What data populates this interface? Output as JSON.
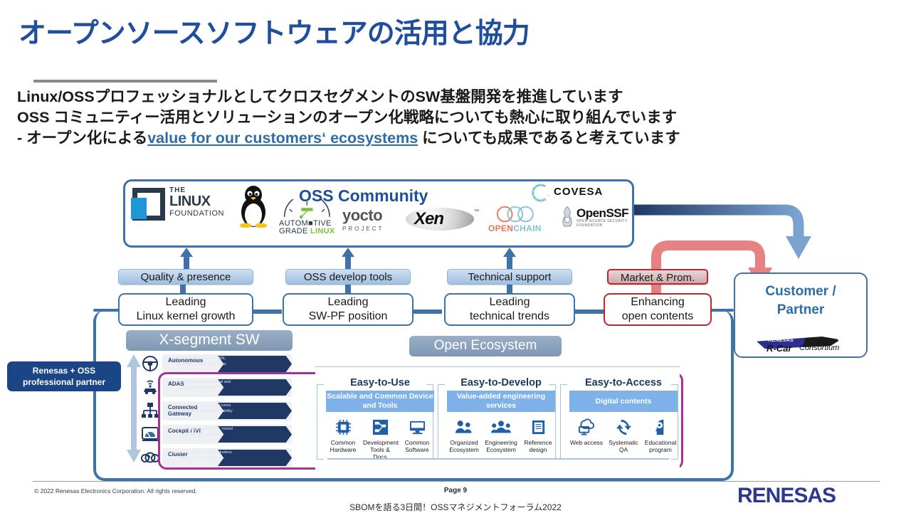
{
  "slide": {
    "title": "オープンソースソフトウェアの活用と協力",
    "lead": [
      "Linux/OSSプロフェッショナルとしてクロスセグメントのSW基盤開発を推進しています",
      "OSS コミュニティー活用とソリューションのオープン化戦略についても熱心に取り組んでいます"
    ],
    "lead3_before": "- オープン化による",
    "lead3_link": "value for our customers‘ ecosystems",
    "lead3_after": " についても成果であると考えています",
    "accent_blue": "#1F4E9C",
    "link_blue": "#2E6DA4",
    "frame_blue": "#3F72A8",
    "magenta": "#A63294",
    "red": "#C0272D"
  },
  "oss_community": {
    "title": "OSS Community",
    "logos": [
      {
        "name": "linux-foundation",
        "the": "THE",
        "main": "LINUX",
        "sub": "FOUNDATION"
      },
      {
        "name": "tux-penguin",
        "label": "Linux Tux"
      },
      {
        "name": "automotive-grade-linux",
        "line1": "AUTOM",
        "line1b": "TIVE",
        "line2": "GRADE ",
        "line2b": "LINUX"
      },
      {
        "name": "yocto-project",
        "main": "yocto",
        "sub": "PROJECT"
      },
      {
        "name": "xen",
        "main": "Xen",
        "tm": "™"
      },
      {
        "name": "openchain",
        "open": "OPEN",
        "chain": "CHAIN"
      },
      {
        "name": "covesa",
        "main": "COVESA"
      },
      {
        "name": "openssf",
        "main": "OpenSSF",
        "sub": "OPEN SOURCE SECURITY FOUNDATION"
      }
    ]
  },
  "pillars": [
    {
      "pill": "Quality & presence",
      "card_line1": "Leading",
      "card_line2": "Linux kernel growth",
      "accent": "blue"
    },
    {
      "pill": "OSS develop tools",
      "card_line1": "Leading",
      "card_line2": "SW-PF position",
      "accent": "blue"
    },
    {
      "pill": "Technical support",
      "card_line1": "Leading",
      "card_line2": "technical trends",
      "accent": "blue"
    },
    {
      "pill": "Market & Prom.",
      "card_line1": "Enhancing",
      "card_line2": "open contents",
      "accent": "red"
    }
  ],
  "xsegment": {
    "header": "X-segment SW",
    "rows": [
      {
        "icon": "steering-wheel-icon",
        "label": "Autonomous",
        "desc": "Powerful and efficient, CNN, supporting complex AD apps"
      },
      {
        "icon": "sensor-car-icon",
        "label": "ADAS",
        "desc": "Power efficient mix of general and accelerated compute IPs"
      },
      {
        "icon": "network-icon",
        "label": "Connected Gateway",
        "desc": "Mix of real time and general cores with advanced networking capability"
      },
      {
        "icon": "cockpit-icon",
        "label": "Cockpit / IVI",
        "desc": "Low latency Hypervisor, QoS, mixed criticality OS and apps"
      },
      {
        "icon": "cluster-gauge-icon",
        "label": "Cluster",
        "desc": "Dedicated HW IP for safety clusters, scalable, $ competitive"
      }
    ]
  },
  "open_ecosystem": {
    "header": "Open Ecosystem",
    "columns": [
      {
        "title": "Easy-to-Use",
        "band": "Scalable and Common Device and Tools",
        "items": [
          {
            "icon": "chip-icon",
            "caption": "Common Hardware"
          },
          {
            "icon": "workflow-icon",
            "caption": "Development Tools & Docs"
          },
          {
            "icon": "monitor-icon",
            "caption": "Common Software"
          }
        ]
      },
      {
        "title": "Easy-to-Develop",
        "band": "Value-added engineering services",
        "items": [
          {
            "icon": "people-small-icon",
            "caption": "Organized Ecosystem"
          },
          {
            "icon": "people-group-icon",
            "caption": "Engineering Ecosystem"
          },
          {
            "icon": "documents-icon",
            "caption": "Reference design"
          }
        ]
      },
      {
        "title": "Easy-to-Access",
        "band": "Digital contents",
        "items": [
          {
            "icon": "cloud-monitor-icon",
            "caption": "Web access"
          },
          {
            "icon": "refresh-icon",
            "caption": "Systematic QA"
          },
          {
            "icon": "head-gear-icon",
            "caption": "Educational program"
          }
        ]
      }
    ]
  },
  "renesas_tag": {
    "line1_strong": "Renesas",
    "line1_small": " + OSS",
    "line2": "professional partner"
  },
  "customer": {
    "line1": "Customer /",
    "line2": "Partner",
    "logo": {
      "name": "r-car-consortium",
      "brand": "RENESAS",
      "main": "R-Car",
      "sub": "Consortium"
    }
  },
  "footer": {
    "copyright": "© 2022 Renesas Electronics Corporation. All rights reserved.",
    "page": "Page 9",
    "forum": "SBOMを語る3日間！OSSマネジメントフォーラム2022",
    "logo": "RENESAS"
  }
}
